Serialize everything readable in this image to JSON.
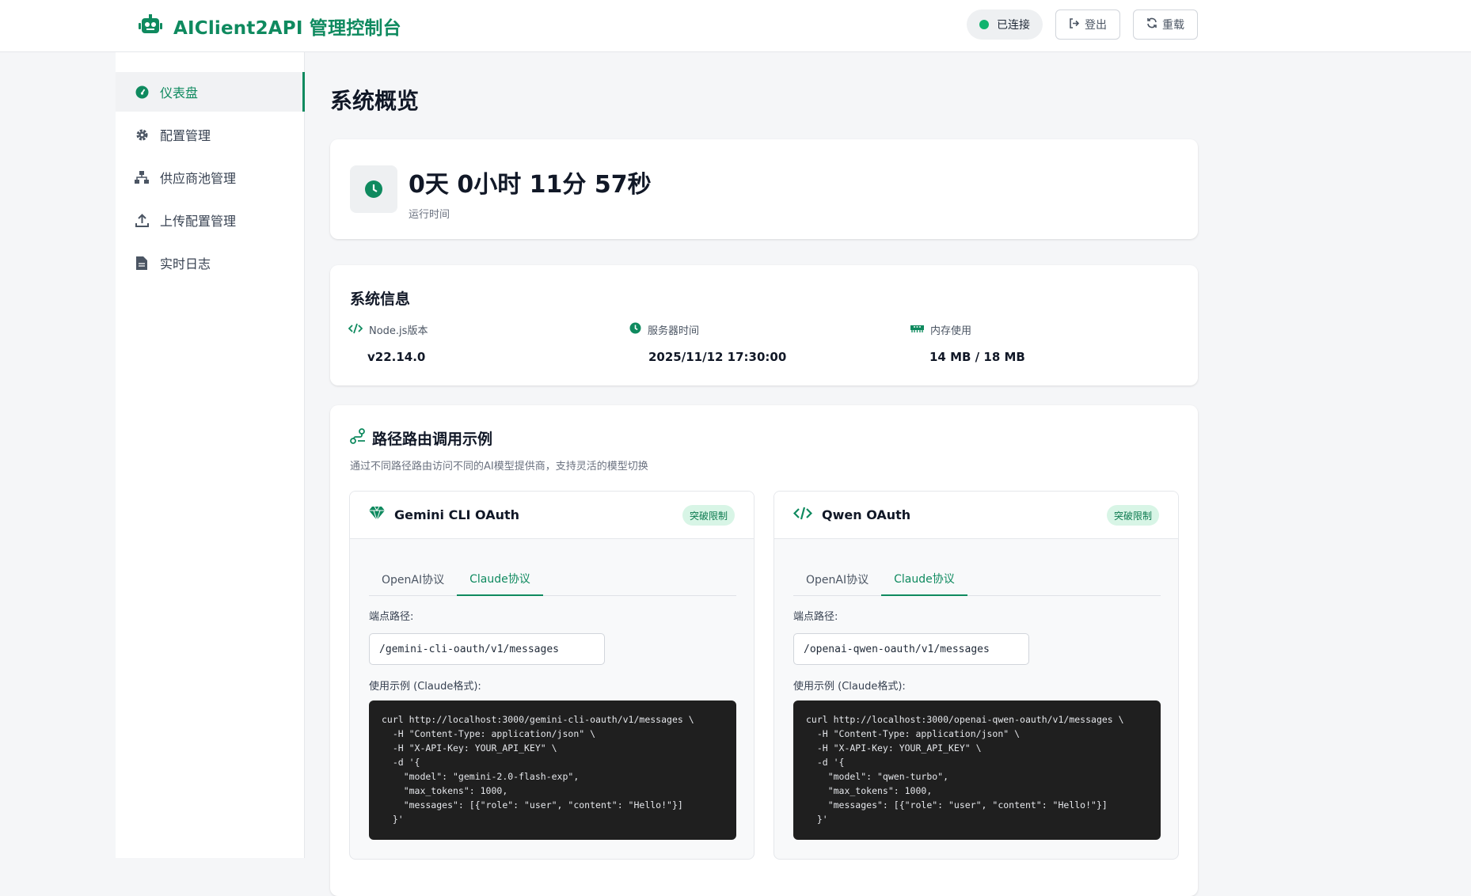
{
  "header": {
    "title": "AIClient2API 管理控制台",
    "logo_icon": "robot-icon",
    "status_label": "已连接",
    "status_color": "#12b36f",
    "logout_label": "登出",
    "reload_label": "重载"
  },
  "sidebar": {
    "items": [
      {
        "label": "仪表盘",
        "icon": "dashboard-icon",
        "active": true
      },
      {
        "label": "配置管理",
        "icon": "gear-icon"
      },
      {
        "label": "供应商池管理",
        "icon": "sitemap-icon"
      },
      {
        "label": "上传配置管理",
        "icon": "upload-icon"
      },
      {
        "label": "实时日志",
        "icon": "file-icon"
      }
    ]
  },
  "main": {
    "page_title": "系统概览",
    "uptime": {
      "value": "0天 0小时 11分 57秒",
      "label": "运行时间"
    },
    "system_info": {
      "title": "系统信息",
      "node_label": "Node.js版本",
      "node_value": "v22.14.0",
      "time_label": "服务器时间",
      "time_value": "2025/11/12 17:30:00",
      "memory_label": "内存使用",
      "memory_value": "14 MB / 18 MB"
    },
    "routes": {
      "title": "路径路由调用示例",
      "description": "通过不同路径路由访问不同的AI模型提供商，支持灵活的模型切换",
      "providers": [
        {
          "name": "Gemini CLI OAuth",
          "icon": "gem-icon",
          "badge": "突破限制",
          "tabs": [
            "OpenAI协议",
            "Claude协议"
          ],
          "active_tab": 1,
          "endpoint_label": "端点路径:",
          "endpoint": "/gemini-cli-oauth/v1/messages",
          "example_label": "使用示例 (Claude格式):",
          "code": "curl http://localhost:3000/gemini-cli-oauth/v1/messages \\\n  -H \"Content-Type: application/json\" \\\n  -H \"X-API-Key: YOUR_API_KEY\" \\\n  -d '{\n    \"model\": \"gemini-2.0-flash-exp\",\n    \"max_tokens\": 1000,\n    \"messages\": [{\"role\": \"user\", \"content\": \"Hello!\"}]\n  }'"
        },
        {
          "name": "Qwen OAuth",
          "icon": "code-icon",
          "badge": "突破限制",
          "tabs": [
            "OpenAI协议",
            "Claude协议"
          ],
          "active_tab": 1,
          "endpoint_label": "端点路径:",
          "endpoint": "/openai-qwen-oauth/v1/messages",
          "example_label": "使用示例 (Claude格式):",
          "code": "curl http://localhost:3000/openai-qwen-oauth/v1/messages \\\n  -H \"Content-Type: application/json\" \\\n  -H \"X-API-Key: YOUR_API_KEY\" \\\n  -d '{\n    \"model\": \"qwen-turbo\",\n    \"max_tokens\": 1000,\n    \"messages\": [{\"role\": \"user\", \"content\": \"Hello!\"}]\n  }'"
        }
      ]
    }
  },
  "colors": {
    "accent": "#0f8a5f",
    "badge_bg": "#d8f5e6",
    "code_bg": "#1f1f1f"
  }
}
